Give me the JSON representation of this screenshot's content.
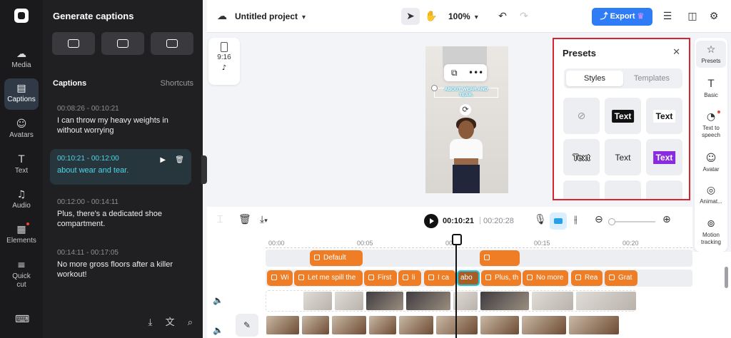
{
  "rail": {
    "items": [
      {
        "label": "Media",
        "icon": "cloud-upload-icon"
      },
      {
        "label": "Captions",
        "icon": "captions-icon"
      },
      {
        "label": "Avatars",
        "icon": "avatar-icon"
      },
      {
        "label": "Text",
        "icon": "text-icon"
      },
      {
        "label": "Audio",
        "icon": "music-note-icon"
      },
      {
        "label": "Elements",
        "icon": "elements-icon"
      },
      {
        "label": "Quick cut",
        "icon": "quick-cut-icon"
      }
    ],
    "active": "Captions"
  },
  "panel": {
    "title": "Generate captions",
    "section_title": "Captions",
    "shortcuts": "Shortcuts",
    "captions": [
      {
        "time": "00:08:26 - 00:10:21",
        "text": "I can throw my heavy weights in without worrying"
      },
      {
        "time": "00:10:21 - 00:12:00",
        "text": "about wear and tear."
      },
      {
        "time": "00:12:00 - 00:14:11",
        "text": "Plus, there's a dedicated shoe compartment."
      },
      {
        "time": "00:14:11 - 00:17:05",
        "text": "No more gross floors after a killer workout!"
      }
    ],
    "active_caption_index": 1
  },
  "topbar": {
    "project_name": "Untitled project",
    "zoom": "100%",
    "export_label": "Export"
  },
  "canvas": {
    "aspect_ratio": "9:16",
    "platform_icon": "tiktok-icon",
    "caption_overlay": "ABOUT WEAR AND TEAR."
  },
  "presets": {
    "title": "Presets",
    "tabs": [
      "Styles",
      "Templates"
    ],
    "active_tab": "Styles",
    "tile_text": "Text"
  },
  "right_tools": [
    {
      "label": "Presets",
      "icon": "presets-icon",
      "active": true
    },
    {
      "label": "Basic",
      "icon": "text-basic-icon"
    },
    {
      "label": "Text to speech",
      "icon": "text-to-speech-icon"
    },
    {
      "label": "Avatar",
      "icon": "avatar-icon"
    },
    {
      "label": "Animat...",
      "icon": "animation-icon"
    },
    {
      "label": "Motion tracking",
      "icon": "motion-tracking-icon"
    }
  ],
  "timeline": {
    "current_time": "00:10:21",
    "total_time": "00:20:28",
    "ruler": [
      "00:00",
      "00:05",
      "00:10",
      "00:15",
      "00:20"
    ],
    "track1": [
      {
        "label": "Default"
      },
      {
        "label": ""
      }
    ],
    "captions_track": [
      "Wi",
      "Let me spill the",
      "First",
      "li",
      "I ca",
      "abo",
      "Plus, th",
      "No more",
      "Rea",
      "Grat"
    ]
  },
  "colors": {
    "accent": "#2e7cf6",
    "caption_clip": "#ee7d25",
    "active_caption": "#4ed5e8",
    "highlight_border": "#d9232d"
  }
}
